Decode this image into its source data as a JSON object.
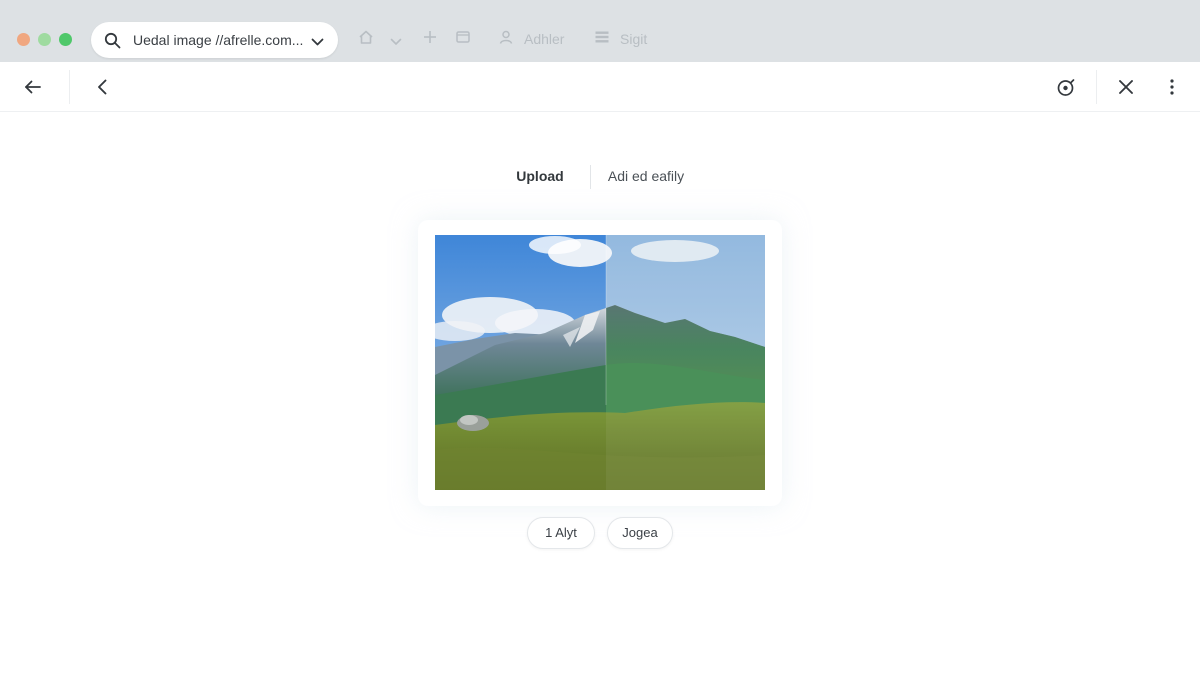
{
  "browser": {
    "address": {
      "text": "Uedal image //afrelle.com..."
    },
    "toolbar": {
      "profile_label": "Adhler",
      "menu_label": "Sigit"
    },
    "window_controls": [
      "close",
      "minimize",
      "maximize"
    ]
  },
  "appbar": {
    "back_icon": "arrow-left-icon",
    "prev_icon": "chevron-left-icon",
    "settings_icon": "target-icon",
    "close_icon": "close-icon",
    "more_icon": "more-vertical-icon"
  },
  "main": {
    "tabs": [
      {
        "label": "Upload",
        "active": true
      },
      {
        "label": "Adi ed eafily",
        "active": false
      }
    ],
    "preview": {
      "image": "mountain-landscape",
      "split_compare": true
    },
    "actions": [
      {
        "label": "1 Alyt"
      },
      {
        "label": "Jogea"
      }
    ]
  },
  "colors": {
    "chrome_bg": "#dde1e4",
    "dot_red": "#f0a780",
    "dot_yellow": "#9fdba0",
    "dot_green": "#4fc86a",
    "sky": "#5a9be0",
    "grass": "#7a8f32"
  }
}
